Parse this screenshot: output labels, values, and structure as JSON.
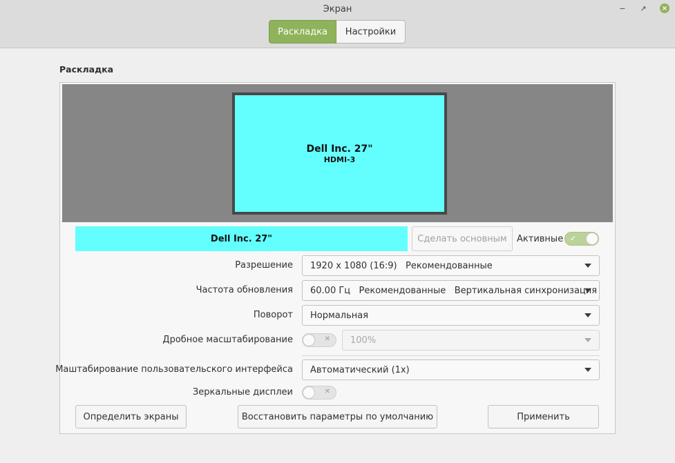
{
  "window": {
    "title": "Экран",
    "tabs": [
      {
        "label": "Раскладка",
        "active": true
      },
      {
        "label": "Настройки",
        "active": false
      }
    ],
    "controls": {
      "minimize_icon": "minimize-icon",
      "maximize_icon": "maximize-icon",
      "close_icon": "close-icon"
    }
  },
  "section": {
    "title": "Раскладка"
  },
  "arrangement": {
    "monitor": {
      "name": "Dell Inc. 27\"",
      "port": "HDMI-3",
      "color": "#63ffff"
    }
  },
  "display": {
    "name": "Dell Inc. 27\"",
    "set_primary_label": "Сделать основным",
    "active_label": "Активные",
    "active": true
  },
  "settings": {
    "resolution": {
      "label": "Разрешение",
      "value": "1920 x 1080 (16:9)   Рекомендованные"
    },
    "refresh": {
      "label": "Частота обновления",
      "value": "60.00 Гц   Рекомендованные   Вертикальная синхронизация"
    },
    "rotation": {
      "label": "Поворот",
      "value": "Нормальная"
    },
    "fractional": {
      "label": "Дробное масштабирование",
      "enabled": false,
      "value": "100%"
    },
    "ui_scale": {
      "label": "Маштабирование пользовательского интерфейса",
      "value": "Автоматический (1x)"
    },
    "mirror": {
      "label": "Зеркальные дисплеи",
      "enabled": false
    }
  },
  "buttons": {
    "identify": "Определить экраны",
    "restore": "Восстановить параметры по умолчанию",
    "apply": "Применить"
  },
  "colors": {
    "accent": "#8fb35a",
    "monitor": "#63ffff",
    "canvas": "#868686"
  }
}
